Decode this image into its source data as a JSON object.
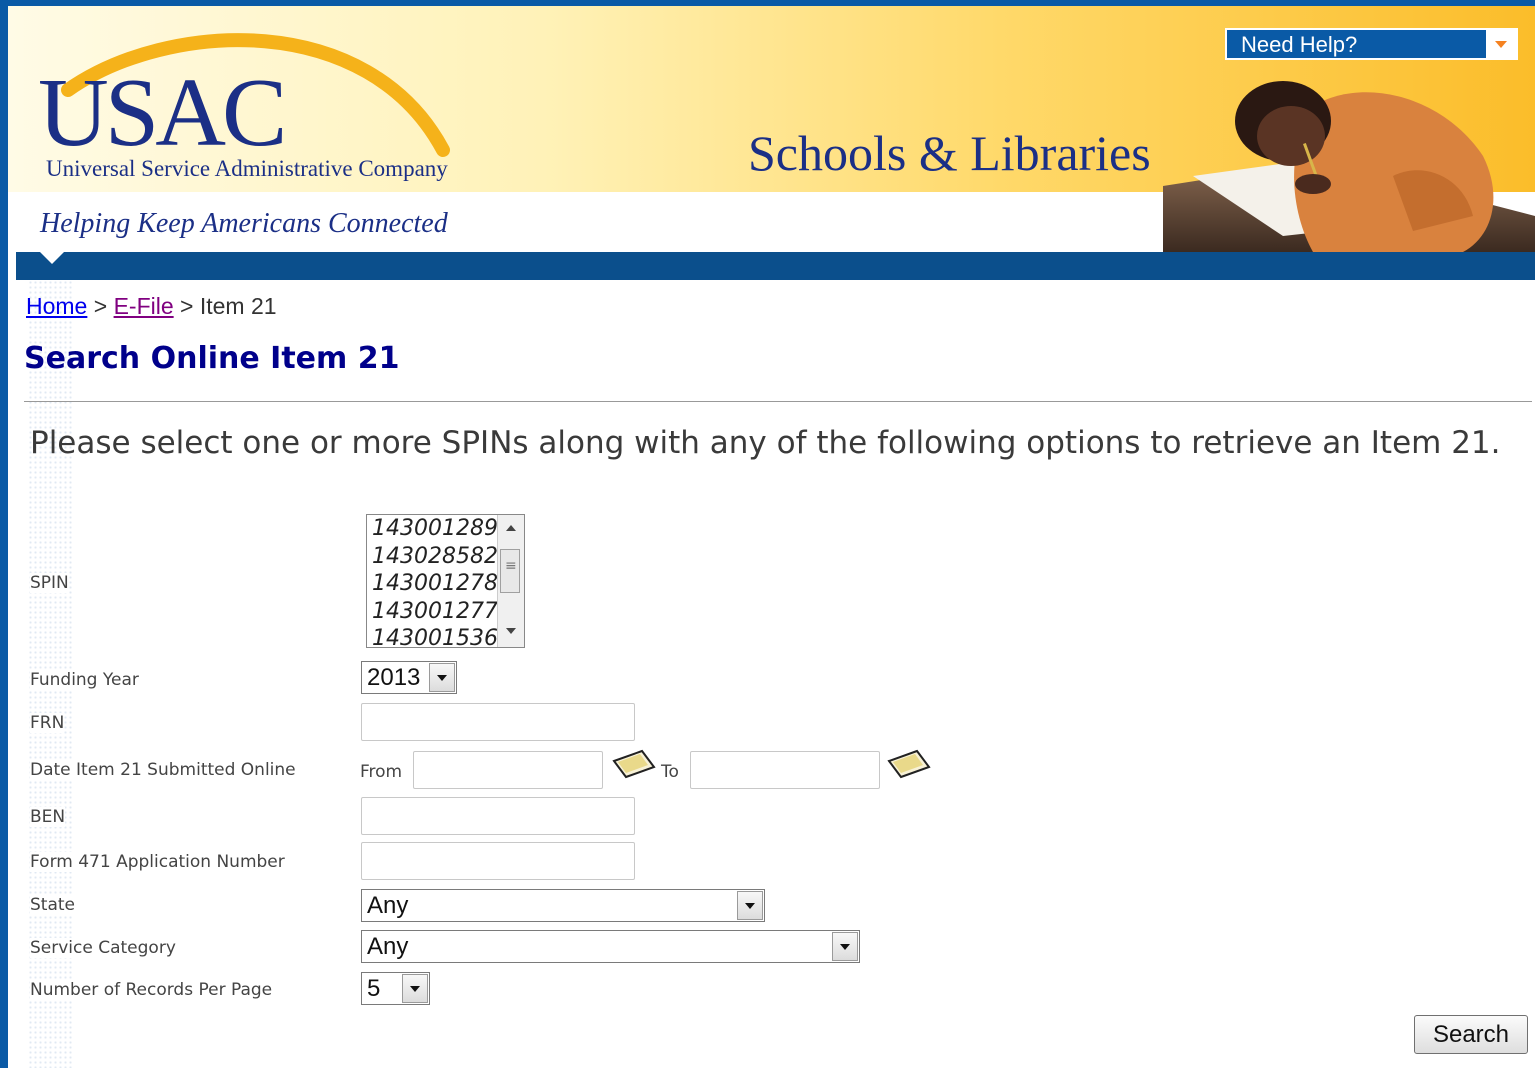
{
  "header": {
    "logo": "USAC",
    "company_name": "Universal Service Administrative Company",
    "tagline": "Helping Keep Americans Connected",
    "program_title": "Schools & Libraries",
    "help_select": "Need Help?"
  },
  "breadcrumb": {
    "home": "Home",
    "sep1": ">",
    "efile": "E-File",
    "sep2": ">",
    "current": "Item 21"
  },
  "page_title": "Search Online Item 21",
  "intro": "Please select one or more SPINs along with any of the following options to retrieve an Item 21.",
  "form": {
    "spin": {
      "label": "SPIN",
      "options": [
        "143001289",
        "143028582",
        "143001278",
        "143001277",
        "143001536"
      ]
    },
    "funding_year": {
      "label": "Funding Year",
      "value": "2013"
    },
    "frn": {
      "label": "FRN",
      "value": ""
    },
    "date_submitted": {
      "label": "Date Item 21 Submitted Online",
      "from_label": "From",
      "to_label": "To",
      "from_value": "",
      "to_value": ""
    },
    "ben": {
      "label": "BEN",
      "value": ""
    },
    "form471": {
      "label": "Form 471 Application Number",
      "value": ""
    },
    "state": {
      "label": "State",
      "value": "Any"
    },
    "service_category": {
      "label": "Service Category",
      "value": "Any"
    },
    "records_per_page": {
      "label": "Number of Records Per Page",
      "value": "5"
    },
    "search_button": "Search"
  },
  "colors": {
    "brand_blue": "#1b2f86",
    "nav_blue": "#0b4f8c",
    "accent_orange": "#f58220",
    "title_blue": "#00008b"
  }
}
